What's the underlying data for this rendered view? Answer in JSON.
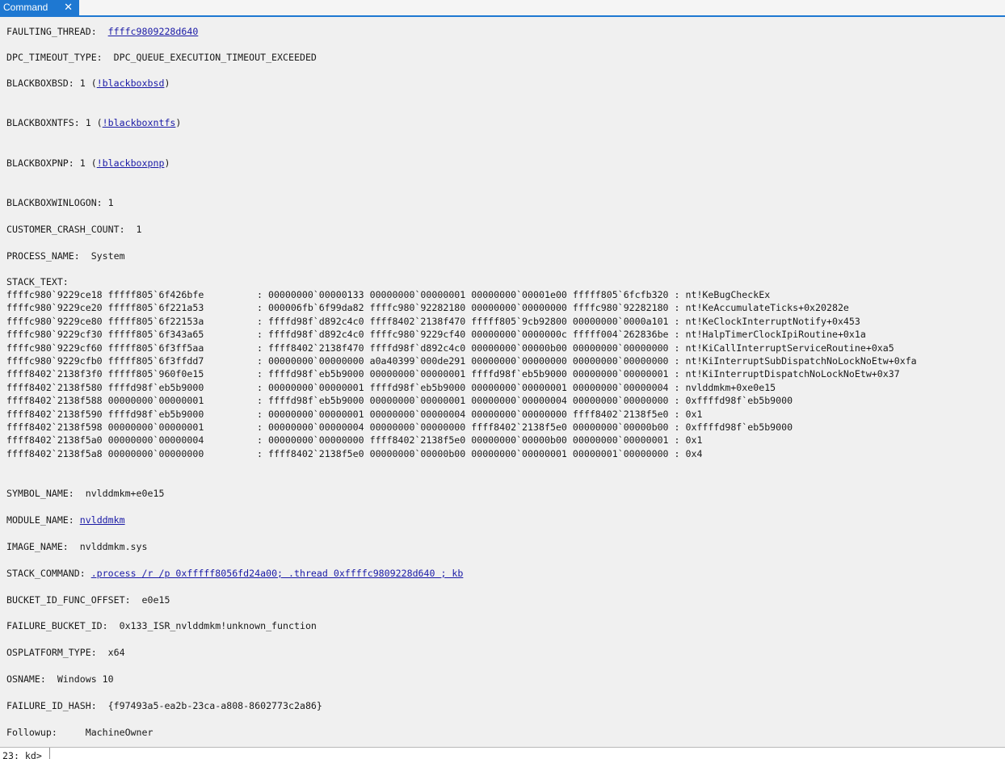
{
  "tab": {
    "title": "Command",
    "close": "✕"
  },
  "fields": {
    "faulting_thread_label": "FAULTING_THREAD:  ",
    "faulting_thread_value": "ffffc9809228d640",
    "dpc_timeout": "DPC_TIMEOUT_TYPE:  DPC_QUEUE_EXECUTION_TIMEOUT_EXCEEDED",
    "blackboxbsd_prefix": "BLACKBOXBSD: 1 (",
    "blackboxbsd_link": "!blackboxbsd",
    "blackboxntfs_prefix": "BLACKBOXNTFS: 1 (",
    "blackboxntfs_link": "!blackboxntfs",
    "blackboxpnp_prefix": "BLACKBOXPNP: 1 (",
    "blackboxpnp_link": "!blackboxpnp",
    "paren_close": ")",
    "blackboxwinlogon": "BLACKBOXWINLOGON: 1",
    "customer_crash_count": "CUSTOMER_CRASH_COUNT:  1",
    "process_name": "PROCESS_NAME:  System",
    "stack_text_label": "STACK_TEXT:",
    "symbol_name": "SYMBOL_NAME:  nvlddmkm+e0e15",
    "module_name_label": "MODULE_NAME: ",
    "module_name_link": "nvlddmkm",
    "image_name": "IMAGE_NAME:  nvlddmkm.sys",
    "stack_command_label": "STACK_COMMAND: ",
    "stack_command_link": ".process /r /p 0xfffff8056fd24a00; .thread 0xffffc9809228d640 ; kb",
    "bucket_id_func_offset": "BUCKET_ID_FUNC_OFFSET:  e0e15",
    "failure_bucket_id": "FAILURE_BUCKET_ID:  0x133_ISR_nvlddmkm!unknown_function",
    "osplatform_type": "OSPLATFORM_TYPE:  x64",
    "osname": "OSNAME:  Windows 10",
    "failure_id_hash": "FAILURE_ID_HASH:  {f97493a5-ea2b-23ca-a808-8602773c2a86}",
    "followup": "Followup:     MachineOwner"
  },
  "stack_rows": [
    [
      "ffffc980`9229ce18 fffff805`6f426bfe",
      ": 00000000`00000133 00000000`00000001 00000000`00001e00 fffff805`6fcfb320 : nt!KeBugCheckEx"
    ],
    [
      "ffffc980`9229ce20 fffff805`6f221a53",
      ": 000006fb`6f99da82 ffffc980`92282180 00000000`00000000 ffffc980`92282180 : nt!KeAccumulateTicks+0x20282e"
    ],
    [
      "ffffc980`9229ce80 fffff805`6f22153a",
      ": ffffd98f`d892c4c0 ffff8402`2138f470 fffff805`9cb92800 00000000`0000a101 : nt!KeClockInterruptNotify+0x453"
    ],
    [
      "ffffc980`9229cf30 fffff805`6f343a65",
      ": ffffd98f`d892c4c0 ffffc980`9229cf40 00000000`0000000c fffff004`262836be : nt!HalpTimerClockIpiRoutine+0x1a"
    ],
    [
      "ffffc980`9229cf60 fffff805`6f3ff5aa",
      ": ffff8402`2138f470 ffffd98f`d892c4c0 00000000`00000b00 00000000`00000000 : nt!KiCallInterruptServiceRoutine+0xa5"
    ],
    [
      "ffffc980`9229cfb0 fffff805`6f3ffdd7",
      ": 00000000`00000000 a0a40399`000de291 00000000`00000000 00000000`00000000 : nt!KiInterruptSubDispatchNoLockNoEtw+0xfa"
    ],
    [
      "ffff8402`2138f3f0 fffff805`960f0e15",
      ": ffffd98f`eb5b9000 00000000`00000001 ffffd98f`eb5b9000 00000000`00000001 : nt!KiInterruptDispatchNoLockNoEtw+0x37"
    ],
    [
      "ffff8402`2138f580 ffffd98f`eb5b9000",
      ": 00000000`00000001 ffffd98f`eb5b9000 00000000`00000001 00000000`00000004 : nvlddmkm+0xe0e15"
    ],
    [
      "ffff8402`2138f588 00000000`00000001",
      ": ffffd98f`eb5b9000 00000000`00000001 00000000`00000004 00000000`00000000 : 0xffffd98f`eb5b9000"
    ],
    [
      "ffff8402`2138f590 ffffd98f`eb5b9000",
      ": 00000000`00000001 00000000`00000004 00000000`00000000 ffff8402`2138f5e0 : 0x1"
    ],
    [
      "ffff8402`2138f598 00000000`00000001",
      ": 00000000`00000004 00000000`00000000 ffff8402`2138f5e0 00000000`00000b00 : 0xffffd98f`eb5b9000"
    ],
    [
      "ffff8402`2138f5a0 00000000`00000004",
      ": 00000000`00000000 ffff8402`2138f5e0 00000000`00000b00 00000000`00000001 : 0x1"
    ],
    [
      "ffff8402`2138f5a8 00000000`00000000",
      ": ffff8402`2138f5e0 00000000`00000b00 00000000`00000001 00000001`00000000 : 0x4"
    ]
  ],
  "command_bar": {
    "prompt": "23: kd>",
    "input_value": "",
    "input_placeholder": ""
  }
}
